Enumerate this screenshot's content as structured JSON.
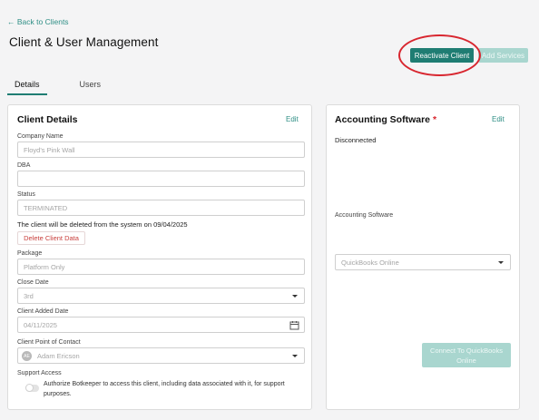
{
  "nav": {
    "back_label": "← Back to Clients"
  },
  "header": {
    "title": "Client & User Management",
    "reactivate_label": "Reactivate Client",
    "add_services_label": "Add Services"
  },
  "tabs": [
    {
      "label": "Details",
      "active": true
    },
    {
      "label": "Users",
      "active": false
    }
  ],
  "client_details": {
    "title": "Client Details",
    "edit_label": "Edit",
    "company_name": {
      "label": "Company Name",
      "value": "Floyd's Pink Wall"
    },
    "dba": {
      "label": "DBA",
      "value": ""
    },
    "status": {
      "label": "Status",
      "value": "TERMINATED"
    },
    "deletion_notice": "The client will be deleted from the system on 09/04/2025",
    "delete_label": "Delete Client Data",
    "package": {
      "label": "Package",
      "value": "Platform Only"
    },
    "close_date": {
      "label": "Close Date",
      "value": "3rd"
    },
    "added_date": {
      "label": "Client Added Date",
      "value": "04/11/2025"
    },
    "point_of_contact": {
      "label": "Client Point of Contact",
      "initials": "AE",
      "value": "Adam Ericson"
    },
    "support_access": {
      "label": "Support Access",
      "description_line1": "Authorize Botkeeper to access this client, including data associated with it, for support",
      "description_line2": "purposes.",
      "enabled": false
    }
  },
  "accounting": {
    "title": "Accounting Software",
    "required_mark": "*",
    "edit_label": "Edit",
    "status": "Disconnected",
    "software_label": "Accounting Software",
    "software_value": "QuickBooks Online",
    "connect_line1": "Connect To QuickBooks",
    "connect_line2": "Online"
  },
  "colors": {
    "brand": "#1f7d73",
    "brand_disabled": "#a9d6cf",
    "highlight": "#d8262f",
    "danger_text": "#c9403d"
  }
}
